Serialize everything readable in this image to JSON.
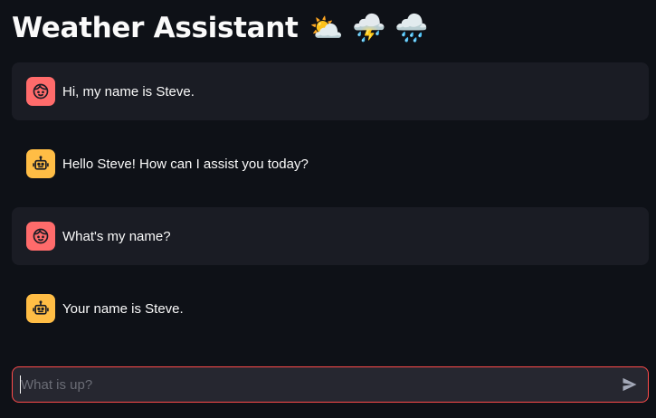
{
  "header": {
    "title": "Weather Assistant",
    "emojis": "⛅ ⛈️ 🌧️"
  },
  "messages": [
    {
      "role": "user",
      "avatar_icon": "user-face-icon",
      "text": "Hi, my name is Steve."
    },
    {
      "role": "assistant",
      "avatar_icon": "robot-icon",
      "text": "Hello Steve! How can I assist you today?"
    },
    {
      "role": "user",
      "avatar_icon": "user-face-icon",
      "text": "What's my name?"
    },
    {
      "role": "assistant",
      "avatar_icon": "robot-icon",
      "text": "Your name is Steve."
    }
  ],
  "chat_input": {
    "placeholder": "What is up?",
    "value": "",
    "send_icon": "send-icon"
  },
  "colors": {
    "background": "#0e1117",
    "user_message_bg": "#1a1c24",
    "user_avatar": "#ff6b6b",
    "assistant_avatar": "#ffbd45",
    "input_border": "#ff4b4b"
  }
}
